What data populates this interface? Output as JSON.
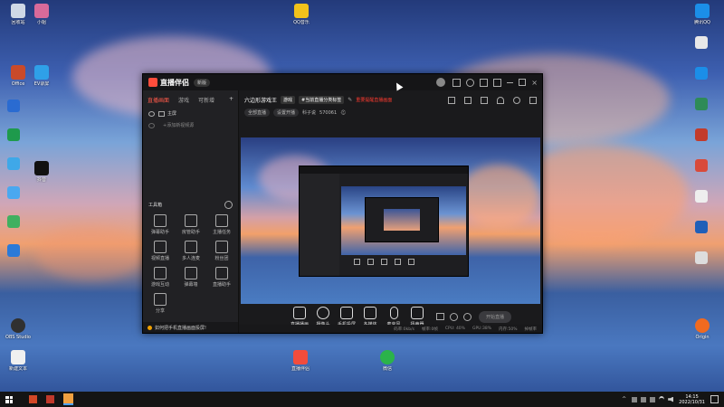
{
  "desktop": {
    "icons": [
      {
        "label": "回收站",
        "color": "#cfd8e6"
      },
      {
        "label": "小姐",
        "color": "#d86a9a"
      },
      {
        "label": "Office",
        "color": "#c94a2a"
      },
      {
        "label": "EV录屏",
        "color": "#2fa0e8"
      },
      {
        "label": "抖音",
        "color": "#111111"
      },
      {
        "label": "OBS Studio",
        "color": "#303030"
      },
      {
        "label": "新建文本",
        "color": "#f0f0f0"
      },
      {
        "label": "QQ音乐",
        "color": "#f2c21b"
      },
      {
        "label": "直播伴侣",
        "color": "#f24c3c"
      },
      {
        "label": "微信",
        "color": "#2bb34a"
      },
      {
        "label": "Origin",
        "color": "#f06a20"
      },
      {
        "label": "腾讯QQ",
        "color": "#1b8ee8"
      }
    ]
  },
  "app": {
    "title": "直播伴侣",
    "badge": "新版",
    "left_tabs": [
      "直播画面",
      "游戏",
      "可新增"
    ],
    "scene_label": "主屏",
    "add_scene": "+添加新视频源",
    "toolbox_title": "工具箱",
    "tools": [
      "弹幕助手",
      "房管助手",
      "主播任务",
      "视频直播",
      "多人连麦",
      "粉丝团",
      "游戏互动",
      "弹幕墙",
      "直播助手",
      "分享"
    ],
    "tip": "如何把手机直播画面投屏!",
    "header": {
      "room_name": "六边形游戏王",
      "tag": "游戏",
      "category": "#当前直播分类标签",
      "warn": "重要提醒直播画面",
      "chip1": "全部直播",
      "chip2": "设置开播",
      "chip3": "科子说",
      "count": "570061"
    },
    "controls": [
      "直播播画",
      "摄像头",
      "手机投屏",
      "多媒体",
      "麦克风",
      "扬声器"
    ],
    "start_button": "开始直播",
    "status": [
      "码率:0kb/s",
      "帧率:0帧",
      "CPU: 40%",
      "GPU:38%",
      "内存:50%",
      "掉帧率"
    ]
  },
  "taskbar": {
    "time": "14:15",
    "date": "2022/10/31"
  }
}
